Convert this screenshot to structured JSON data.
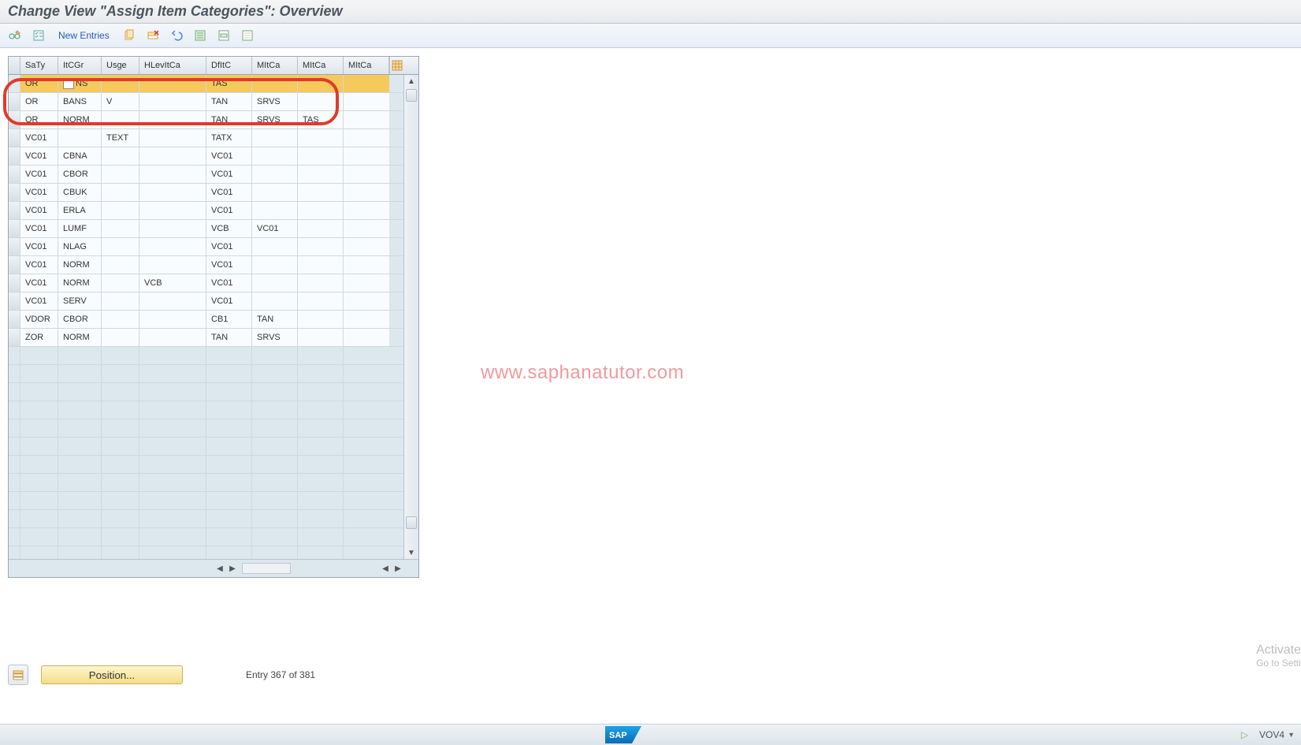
{
  "title": "Change View \"Assign Item Categories\": Overview",
  "toolbar": {
    "new_entries": "New Entries"
  },
  "columns": {
    "saty": "SaTy",
    "itcgr": "ItCGr",
    "usge": "Usge",
    "hlevitca": "HLevItCa",
    "dfitc": "DfItC",
    "mitca1": "MItCa",
    "mitca2": "MItCa",
    "mitca3": "MItCa"
  },
  "rows": [
    {
      "saty": "OR",
      "itcgr": "NS",
      "usge": "",
      "hlev": "",
      "dfitc": "TAS",
      "m1": "",
      "m2": "",
      "m3": "",
      "sel": true,
      "f4": true
    },
    {
      "saty": "OR",
      "itcgr": "BANS",
      "usge": "V",
      "hlev": "",
      "dfitc": "TAN",
      "m1": "SRVS",
      "m2": "",
      "m3": ""
    },
    {
      "saty": "OR",
      "itcgr": "NORM",
      "usge": "",
      "hlev": "",
      "dfitc": "TAN",
      "m1": "SRVS",
      "m2": "TAS",
      "m3": ""
    },
    {
      "saty": "VC01",
      "itcgr": "",
      "usge": "TEXT",
      "hlev": "",
      "dfitc": "TATX",
      "m1": "",
      "m2": "",
      "m3": ""
    },
    {
      "saty": "VC01",
      "itcgr": "CBNA",
      "usge": "",
      "hlev": "",
      "dfitc": "VC01",
      "m1": "",
      "m2": "",
      "m3": ""
    },
    {
      "saty": "VC01",
      "itcgr": "CBOR",
      "usge": "",
      "hlev": "",
      "dfitc": "VC01",
      "m1": "",
      "m2": "",
      "m3": ""
    },
    {
      "saty": "VC01",
      "itcgr": "CBUK",
      "usge": "",
      "hlev": "",
      "dfitc": "VC01",
      "m1": "",
      "m2": "",
      "m3": ""
    },
    {
      "saty": "VC01",
      "itcgr": "ERLA",
      "usge": "",
      "hlev": "",
      "dfitc": "VC01",
      "m1": "",
      "m2": "",
      "m3": ""
    },
    {
      "saty": "VC01",
      "itcgr": "LUMF",
      "usge": "",
      "hlev": "",
      "dfitc": "VCB",
      "m1": "VC01",
      "m2": "",
      "m3": ""
    },
    {
      "saty": "VC01",
      "itcgr": "NLAG",
      "usge": "",
      "hlev": "",
      "dfitc": "VC01",
      "m1": "",
      "m2": "",
      "m3": ""
    },
    {
      "saty": "VC01",
      "itcgr": "NORM",
      "usge": "",
      "hlev": "",
      "dfitc": "VC01",
      "m1": "",
      "m2": "",
      "m3": ""
    },
    {
      "saty": "VC01",
      "itcgr": "NORM",
      "usge": "",
      "hlev": "VCB",
      "dfitc": "VC01",
      "m1": "",
      "m2": "",
      "m3": ""
    },
    {
      "saty": "VC01",
      "itcgr": "SERV",
      "usge": "",
      "hlev": "",
      "dfitc": "VC01",
      "m1": "",
      "m2": "",
      "m3": ""
    },
    {
      "saty": "VDOR",
      "itcgr": "CBOR",
      "usge": "",
      "hlev": "",
      "dfitc": "CB1",
      "m1": "TAN",
      "m2": "",
      "m3": ""
    },
    {
      "saty": "ZOR",
      "itcgr": "NORM",
      "usge": "",
      "hlev": "",
      "dfitc": "TAN",
      "m1": "SRVS",
      "m2": "",
      "m3": ""
    }
  ],
  "empty_rows": 13,
  "footer": {
    "position_btn": "Position...",
    "entry_text": "Entry 367 of 381"
  },
  "watermark": "www.saphanatutor.com",
  "activate_hint": {
    "line1": "Activate",
    "line2": "Go to Setti"
  },
  "status": {
    "tcode": "VOV4",
    "sap": "SAP"
  }
}
